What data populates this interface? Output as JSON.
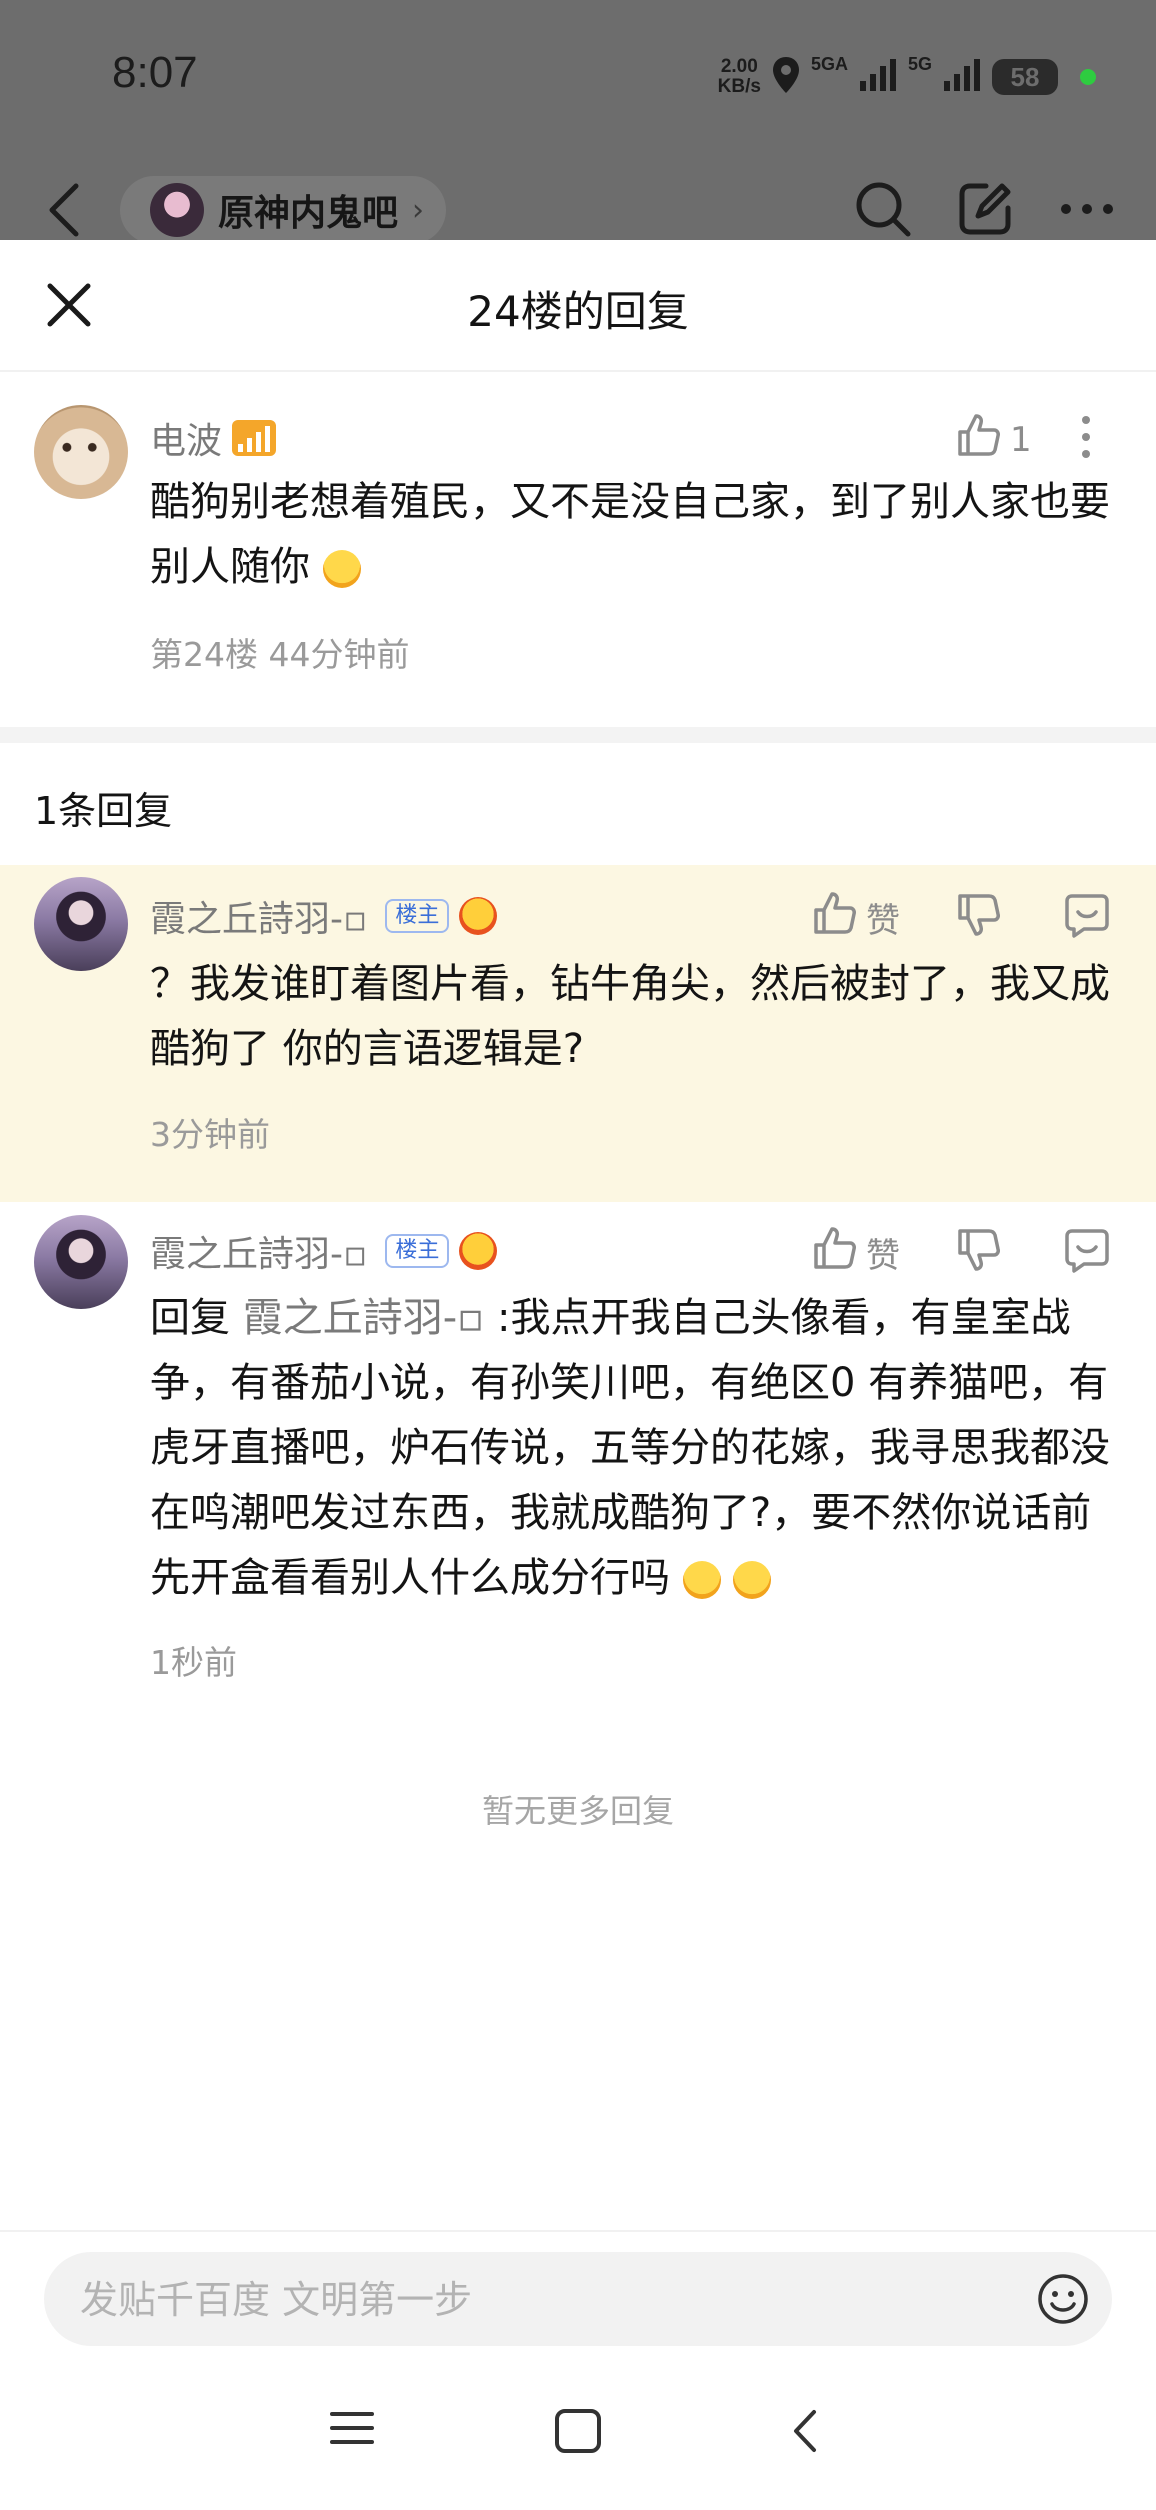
{
  "status_bar": {
    "time": "8:07",
    "net_speed_value": "2.00",
    "net_speed_unit": "KB/s",
    "signal1_label": "5GA",
    "signal2_label": "5G",
    "battery": "58"
  },
  "background_nav": {
    "forum_name": "原神内鬼吧",
    "chevron": "›"
  },
  "sheet": {
    "title": "24楼的回复"
  },
  "main_post": {
    "username": "电波",
    "like_count": "1",
    "content": "酷狗别老想着殖民，又不是没自己家，到了别人家也要别人随你",
    "floor_meta": "第24楼 44分钟前"
  },
  "replies_header": "1条回复",
  "replies": [
    {
      "username": "霞之丘詩羽-▫",
      "badge": "楼主",
      "like_label": "赞",
      "content": "？我发谁盯着图片看，钻牛角尖，然后被封了，我又成酷狗了 你的言语逻辑是?",
      "time": "3分钟前"
    },
    {
      "username": "霞之丘詩羽-▫",
      "badge": "楼主",
      "like_label": "赞",
      "reply_prefix": "回复 ",
      "reply_target": "霞之丘詩羽-▫",
      "content": "  :我点开我自己头像看，有皇室战争，有番茄小说，有孙笑川吧，有绝区0 有养猫吧，有虎牙直播吧，炉石传说，五等分的花嫁，我寻思我都没在鸣潮吧发过东西，我就成酷狗了?，要不然你说话前 先开盒看看别人什么成分行吗",
      "time": "1秒前"
    }
  ],
  "no_more": "暂无更多回复",
  "input": {
    "placeholder": "发贴千百度 文明第一步"
  },
  "colors": {
    "highlight_bg": "#fcf7e2",
    "host_badge": "#3a6ed8",
    "dim_overlay": "#6d6d6d"
  }
}
